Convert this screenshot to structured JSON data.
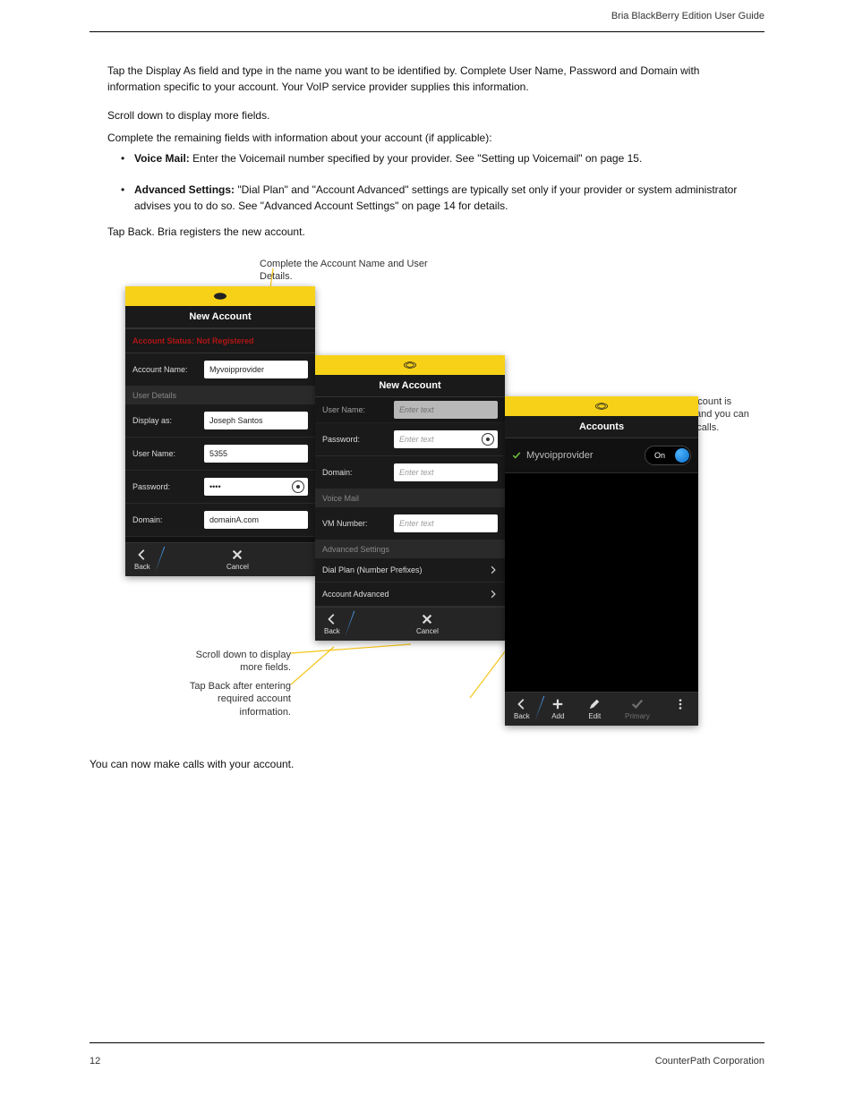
{
  "header": {
    "right_text": "Bria BlackBerry Edition User Guide"
  },
  "footer": {
    "page_num": "12",
    "company": "CounterPath Corporation"
  },
  "intro": {
    "p1": "Tap the Display As field and type in the name you want to be identified by. Complete User Name, Password and Domain with information specific to your account. Your VoIP service provider supplies this information.",
    "p2": "Scroll down to display more fields.",
    "p3": "Complete the remaining fields with information about your account (if applicable):",
    "b1_label": "Voice Mail:",
    "b1_text": " Enter the Voicemail number specified by your provider. See \"Setting up Voicemail\" on page 15.",
    "b2_label": "Advanced Settings:",
    "b2_text": " \"Dial Plan\" and \"Account Advanced\" settings are typically set only if your provider or system administrator advises you to do so. See \"Advanced Account Settings\" on page 14 for details.",
    "p4": "Tap Back. Bria registers the new account.",
    "post": "You can now make calls with your account."
  },
  "callouts": {
    "top": "Complete the Account Name and User Details.",
    "mid1": "Scroll down to display more fields.",
    "mid2": "Tap Back after entering required account information.",
    "right": "The SIP account is registered and you can now make calls."
  },
  "screen1": {
    "title": "New Account",
    "status": "Account Status: Not Registered",
    "acct_name_lbl": "Account Name:",
    "acct_name_val": "Myvoipprovider",
    "section_user": "User Details",
    "display_lbl": "Display as:",
    "display_val": "Joseph Santos",
    "username_lbl": "User Name:",
    "username_val": "5355",
    "password_lbl": "Password:",
    "password_val": "••••",
    "domain_lbl": "Domain:",
    "domain_val": "domainA.com",
    "back": "Back",
    "cancel": "Cancel"
  },
  "screen2": {
    "title": "New Account",
    "username_lbl": "User Name:",
    "password_lbl": "Password:",
    "domain_lbl": "Domain:",
    "placeholder": "Enter text",
    "section_vm": "Voice Mail",
    "vm_lbl": "VM Number:",
    "section_adv": "Advanced Settings",
    "dialplan": "Dial Plan (Number Prefixes)",
    "acct_adv": "Account Advanced",
    "back": "Back",
    "cancel": "Cancel"
  },
  "screen3": {
    "title": "Accounts",
    "acct": "Myvoipprovider",
    "toggle": "On",
    "back": "Back",
    "add": "Add",
    "edit": "Edit",
    "primary": "Primary"
  }
}
